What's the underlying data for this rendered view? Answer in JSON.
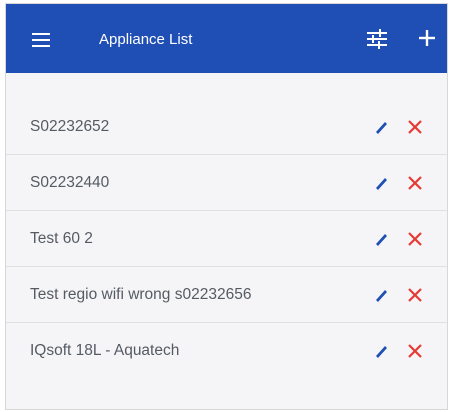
{
  "appbar": {
    "title": "Appliance List",
    "menu_icon": "hamburger-menu-icon",
    "filter_icon": "tune-sliders-icon",
    "add_icon": "plus-icon",
    "background": "#1f4fb4"
  },
  "appliances": [
    {
      "name": "S02232652"
    },
    {
      "name": "S02232440"
    },
    {
      "name": "Test 60 2"
    },
    {
      "name": "Test regio wifi wrong s02232656"
    },
    {
      "name": "IQsoft 18L - Aquatech"
    }
  ],
  "row_actions": {
    "edit_icon": "pencil-icon",
    "delete_icon": "close-x-icon",
    "edit_color": "#1f4fb4",
    "delete_color": "#e53935"
  }
}
